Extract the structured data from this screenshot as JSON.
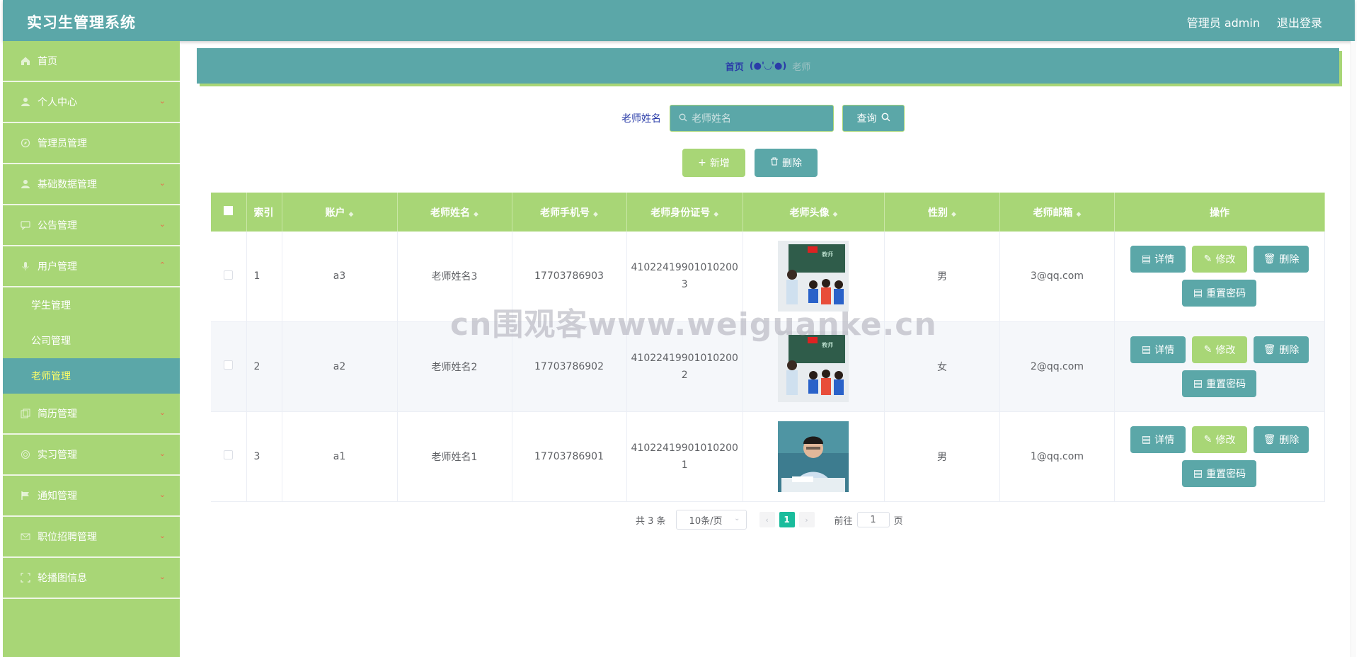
{
  "header": {
    "title": "实习生管理系统",
    "admin_label": "管理员 admin",
    "logout": "退出登录"
  },
  "sidebar": {
    "items": [
      {
        "label": "首页",
        "icon": "home-icon"
      },
      {
        "label": "个人中心",
        "icon": "user-icon"
      },
      {
        "label": "管理员管理",
        "icon": "compass-icon"
      },
      {
        "label": "基础数据管理",
        "icon": "user-icon"
      },
      {
        "label": "公告管理",
        "icon": "chat-icon"
      },
      {
        "label": "用户管理",
        "icon": "mic-icon"
      },
      {
        "label": "简历管理",
        "icon": "copy-icon"
      },
      {
        "label": "实习管理",
        "icon": "target-icon"
      },
      {
        "label": "通知管理",
        "icon": "flag-icon"
      },
      {
        "label": "职位招聘管理",
        "icon": "mail-icon"
      },
      {
        "label": "轮播图信息",
        "icon": "fullscreen-icon"
      }
    ],
    "sub_items": [
      "学生管理",
      "公司管理",
      "老师管理"
    ]
  },
  "breadcrumb": {
    "home": "首页",
    "sep": "(●'◡'●)",
    "current": "老师"
  },
  "search": {
    "label": "老师姓名",
    "placeholder": "老师姓名",
    "query": "查询"
  },
  "actions": {
    "add": "新增",
    "delete": "删除"
  },
  "table": {
    "headers": [
      "索引",
      "账户",
      "老师姓名",
      "老师手机号",
      "老师身份证号",
      "老师头像",
      "性别",
      "老师邮箱",
      "操作"
    ],
    "rows": [
      {
        "index": "1",
        "account": "a3",
        "name": "老师姓名3",
        "phone": "17703786903",
        "id_line1": "41022419901010200",
        "id_line2": "3",
        "gender": "男",
        "email": "3@qq.com"
      },
      {
        "index": "2",
        "account": "a2",
        "name": "老师姓名2",
        "phone": "17703786902",
        "id_line1": "41022419901010200",
        "id_line2": "2",
        "gender": "女",
        "email": "2@qq.com"
      },
      {
        "index": "3",
        "account": "a1",
        "name": "老师姓名1",
        "phone": "17703786901",
        "id_line1": "41022419901010200",
        "id_line2": "1",
        "gender": "男",
        "email": "1@qq.com"
      }
    ],
    "ops": {
      "detail": "详情",
      "edit": "修改",
      "delete": "删除",
      "reset": "重置密码"
    }
  },
  "pager": {
    "total": "共 3 条",
    "size": "10条/页",
    "page": "1",
    "goto": "前往",
    "goto_value": "1",
    "page_suffix": "页"
  },
  "watermark": "cn围观客www.weiguanke.cn",
  "colors": {
    "teal": "#5ba7a8",
    "green": "#a8d676",
    "active_text": "#ffff66"
  }
}
